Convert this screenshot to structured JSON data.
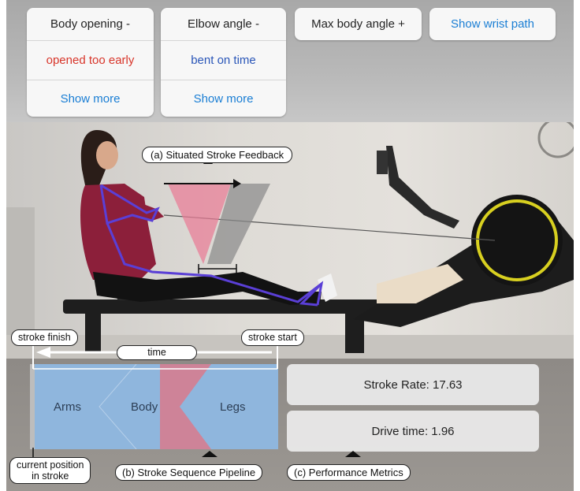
{
  "top_controls": {
    "body_opening": {
      "title": "Body opening -",
      "status": "opened too early",
      "more": "Show more"
    },
    "elbow_angle": {
      "title": "Elbow angle -",
      "status": "bent on time",
      "more": "Show more"
    },
    "max_body_angle": {
      "label": "Max body angle +"
    },
    "wrist_path": {
      "label": "Show wrist path"
    }
  },
  "annotations": {
    "situated_feedback": "(a) Situated Stroke Feedback",
    "stroke_finish": "stroke finish",
    "stroke_start": "stroke start",
    "time": "time",
    "current_position_line1": "current position",
    "current_position_line2": "in stroke",
    "pipeline": "(b) Stroke Sequence Pipeline",
    "metrics": "(c) Performance Metrics"
  },
  "pipeline": {
    "arms": "Arms",
    "body": "Body",
    "legs": "Legs"
  },
  "metrics": {
    "stroke_rate": "Stroke Rate: 17.63",
    "drive_time": "Drive time: 1.96"
  },
  "colors": {
    "link": "#1a7ed4",
    "warning": "#d8352a",
    "ok": "#2a56b8",
    "pipeline": "#8fb6dd",
    "highlight": "#d97a8c",
    "skeleton": "#5a3fd6"
  }
}
